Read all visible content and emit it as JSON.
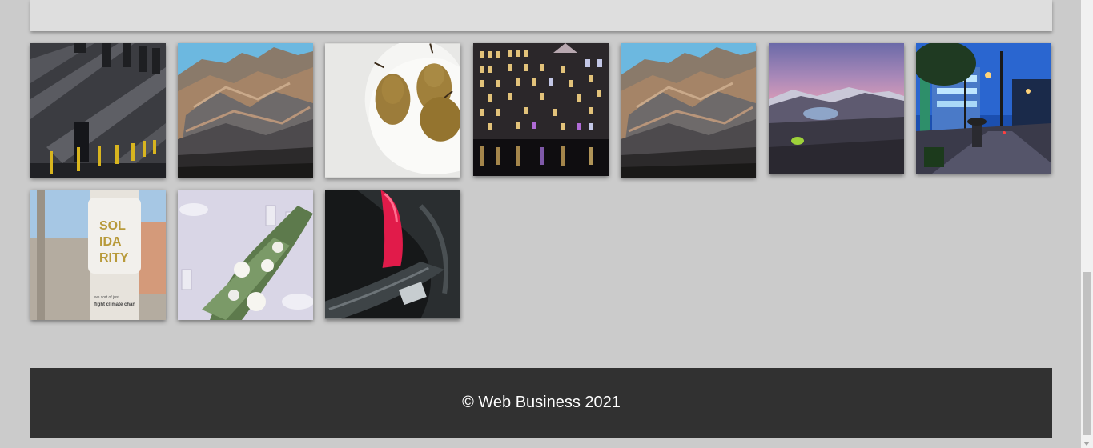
{
  "gallery": {
    "images": [
      {
        "name": "building-shadows-photo"
      },
      {
        "name": "mountain-cliff-photo"
      },
      {
        "name": "pears-bowl-photo"
      },
      {
        "name": "canal-houses-night-photo"
      },
      {
        "name": "mountain-cliff-photo-2"
      },
      {
        "name": "mountain-lake-dusk-photo"
      },
      {
        "name": "city-street-night-photo"
      },
      {
        "name": "solidarity-sticker-photo"
      },
      {
        "name": "table-flowers-photo"
      },
      {
        "name": "neon-sign-photo"
      }
    ],
    "sticker_text": [
      "SOL",
      "IDA",
      "RITY"
    ],
    "sticker_small_text": [
      "we sort of just ...",
      "fight climate chan"
    ]
  },
  "footer": {
    "copyright": "© Web Business 2021"
  },
  "colors": {
    "page_bg": "#cbcbcb",
    "footer_bg": "#313131",
    "top_panel_bg": "#dedede"
  }
}
